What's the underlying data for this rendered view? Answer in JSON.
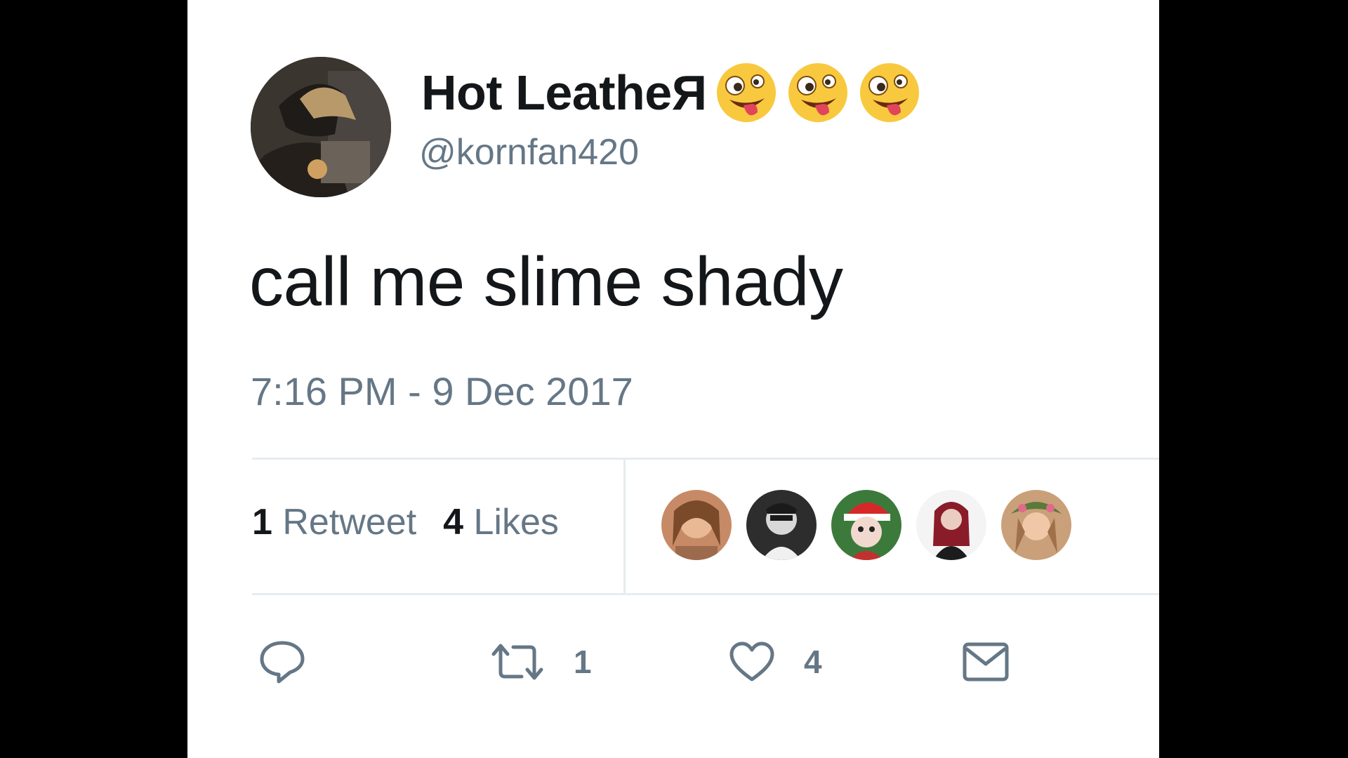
{
  "tweet": {
    "display_name": "Hot LeatheЯ",
    "name_emojis": [
      "zany-face-emoji",
      "zany-face-emoji",
      "zany-face-emoji"
    ],
    "handle": "@kornfan420",
    "text": "call me slime shady",
    "timestamp": "7:16 PM - 9 Dec 2017"
  },
  "stats": {
    "retweets_count": "1",
    "retweets_label": "Retweet",
    "likes_count": "4",
    "likes_label": "Likes",
    "liker_avatars": 5
  },
  "actions": {
    "reply": {
      "icon": "reply-icon"
    },
    "retweet": {
      "icon": "retweet-icon",
      "count": "1"
    },
    "like": {
      "icon": "heart-icon",
      "count": "4"
    },
    "message": {
      "icon": "envelope-icon"
    }
  },
  "colors": {
    "text_primary": "#14171a",
    "text_secondary": "#657786",
    "divider": "#e6ecf0",
    "background": "#ffffff",
    "emoji_face": "#f8c93e"
  }
}
